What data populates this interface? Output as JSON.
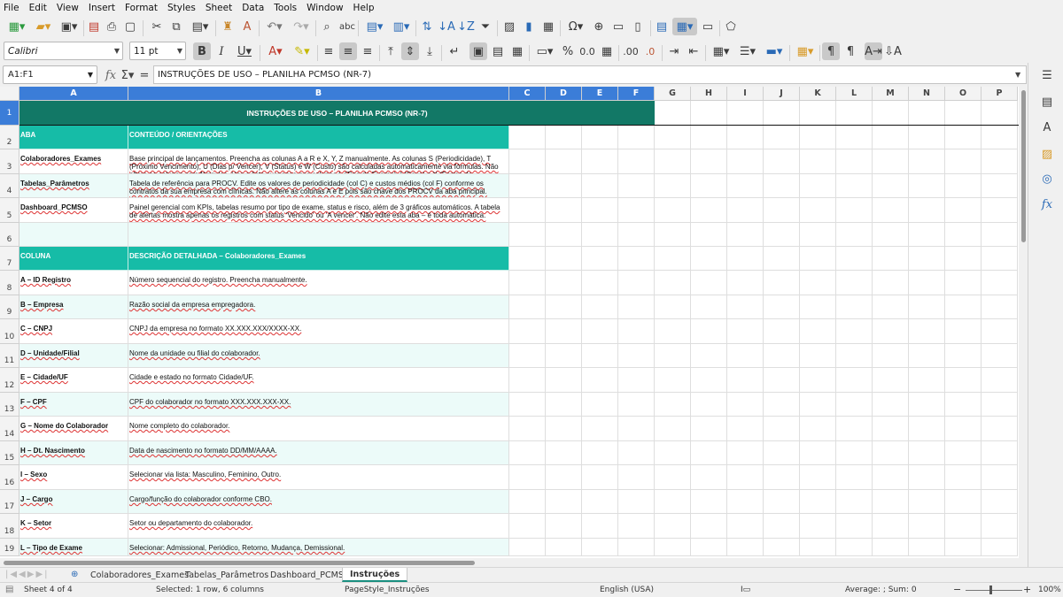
{
  "menu": [
    "File",
    "Edit",
    "View",
    "Insert",
    "Format",
    "Styles",
    "Sheet",
    "Data",
    "Tools",
    "Window",
    "Help"
  ],
  "font": {
    "name": "Calibri",
    "size": "11 pt"
  },
  "formula_bar": {
    "cell_ref": "A1:F1",
    "content": "INSTRUÇÕES DE USO – PLANILHA PCMSO (NR-7)",
    "fx_symbol": "fx",
    "sum_symbol": "Σ",
    "eq_symbol": "="
  },
  "columns": [
    "A",
    "B",
    "C",
    "D",
    "E",
    "F",
    "G",
    "H",
    "I",
    "J",
    "K",
    "L",
    "M",
    "N",
    "O",
    "P"
  ],
  "rows": [
    "1",
    "2",
    "3",
    "4",
    "5",
    "6",
    "7",
    "8",
    "9",
    "10",
    "11",
    "12",
    "13",
    "14",
    "15",
    "16",
    "17",
    "18",
    "19"
  ],
  "sheet": {
    "title": "INSTRUÇÕES DE USO – PLANILHA PCMSO (NR-7)",
    "section1": {
      "col_a": "ABA",
      "col_b": "CONTEÚDO / ORIENTAÇÕES"
    },
    "abas": [
      {
        "name": "Colaboradores_Exames",
        "desc": "Base principal de lançamentos. Preencha as colunas A a R e X, Y, Z manualmente. As colunas S (Periodicidade), T (Próximo Vencimento), U (Dias p/ Vencer), V (Status) e W (Custo) são calculadas automaticamente via fórmulas. Não altere as colunas com fórmulas. Use a lista suspensa nas colunas L (Tipo de Exame), I (Sexo) e X (Forma de Pagamento)."
      },
      {
        "name": "Tabelas_Parâmetros",
        "desc": "Tabela de referência para PROCV. Edite os valores de periodicidade (col C) e custos médios (col F) conforme os contratos da sua empresa com clínicas. Não altere as colunas A e E pois são chave dos PROCV da aba principal."
      },
      {
        "name": "Dashboard_PCMSO",
        "desc": "Painel gerencial com KPIs, tabelas resumo por tipo de exame, status e risco, além de 3 gráficos automáticos. A tabela de alertas mostra apenas os registros com status 'Vencido' ou 'A vencer'. Não edite esta aba – é toda automática."
      }
    ],
    "section2": {
      "col_a": "COLUNA",
      "col_b": "DESCRIÇÃO DETALHADA – Colaboradores_Exames"
    },
    "colunas": [
      {
        "name": "A – ID Registro",
        "desc": "Número sequencial do registro. Preencha manualmente."
      },
      {
        "name": "B – Empresa",
        "desc": "Razão social da empresa empregadora."
      },
      {
        "name": "C – CNPJ",
        "desc": "CNPJ da empresa no formato XX.XXX.XXX/XXXX-XX."
      },
      {
        "name": "D – Unidade/Filial",
        "desc": "Nome da unidade ou filial do colaborador."
      },
      {
        "name": "E – Cidade/UF",
        "desc": "Cidade e estado no formato Cidade/UF."
      },
      {
        "name": "F – CPF",
        "desc": "CPF do colaborador no formato XXX.XXX.XXX-XX."
      },
      {
        "name": "G – Nome do Colaborador",
        "desc": "Nome completo do colaborador."
      },
      {
        "name": "H – Dt. Nascimento",
        "desc": "Data de nascimento no formato DD/MM/AAAA."
      },
      {
        "name": "I – Sexo",
        "desc": "Selecionar via lista: Masculino, Feminino, Outro."
      },
      {
        "name": "J – Cargo",
        "desc": "Cargo/função do colaborador conforme CBO."
      },
      {
        "name": "K – Setor",
        "desc": "Setor ou departamento do colaborador."
      },
      {
        "name": "L – Tipo de Exame",
        "desc": "Selecionar: Admissional, Periódico, Retorno, Mudança, Demissional."
      }
    ]
  },
  "tabs": [
    "Colaboradores_Exames",
    "Tabelas_Parâmetros",
    "Dashboard_PCMSO",
    "Instruções"
  ],
  "status": {
    "sheet": "Sheet 4 of 4",
    "selection": "Selected: 1 row, 6 columns",
    "page_style": "PageStyle_Instruções",
    "language": "English (USA)",
    "summary": "Average: ; Sum: 0",
    "zoom": "100%"
  },
  "colors": {
    "title_bg": "#127866",
    "header_bg": "#16bca7",
    "light_row": "#ecfbf9",
    "selection": "#3b7dd8"
  }
}
